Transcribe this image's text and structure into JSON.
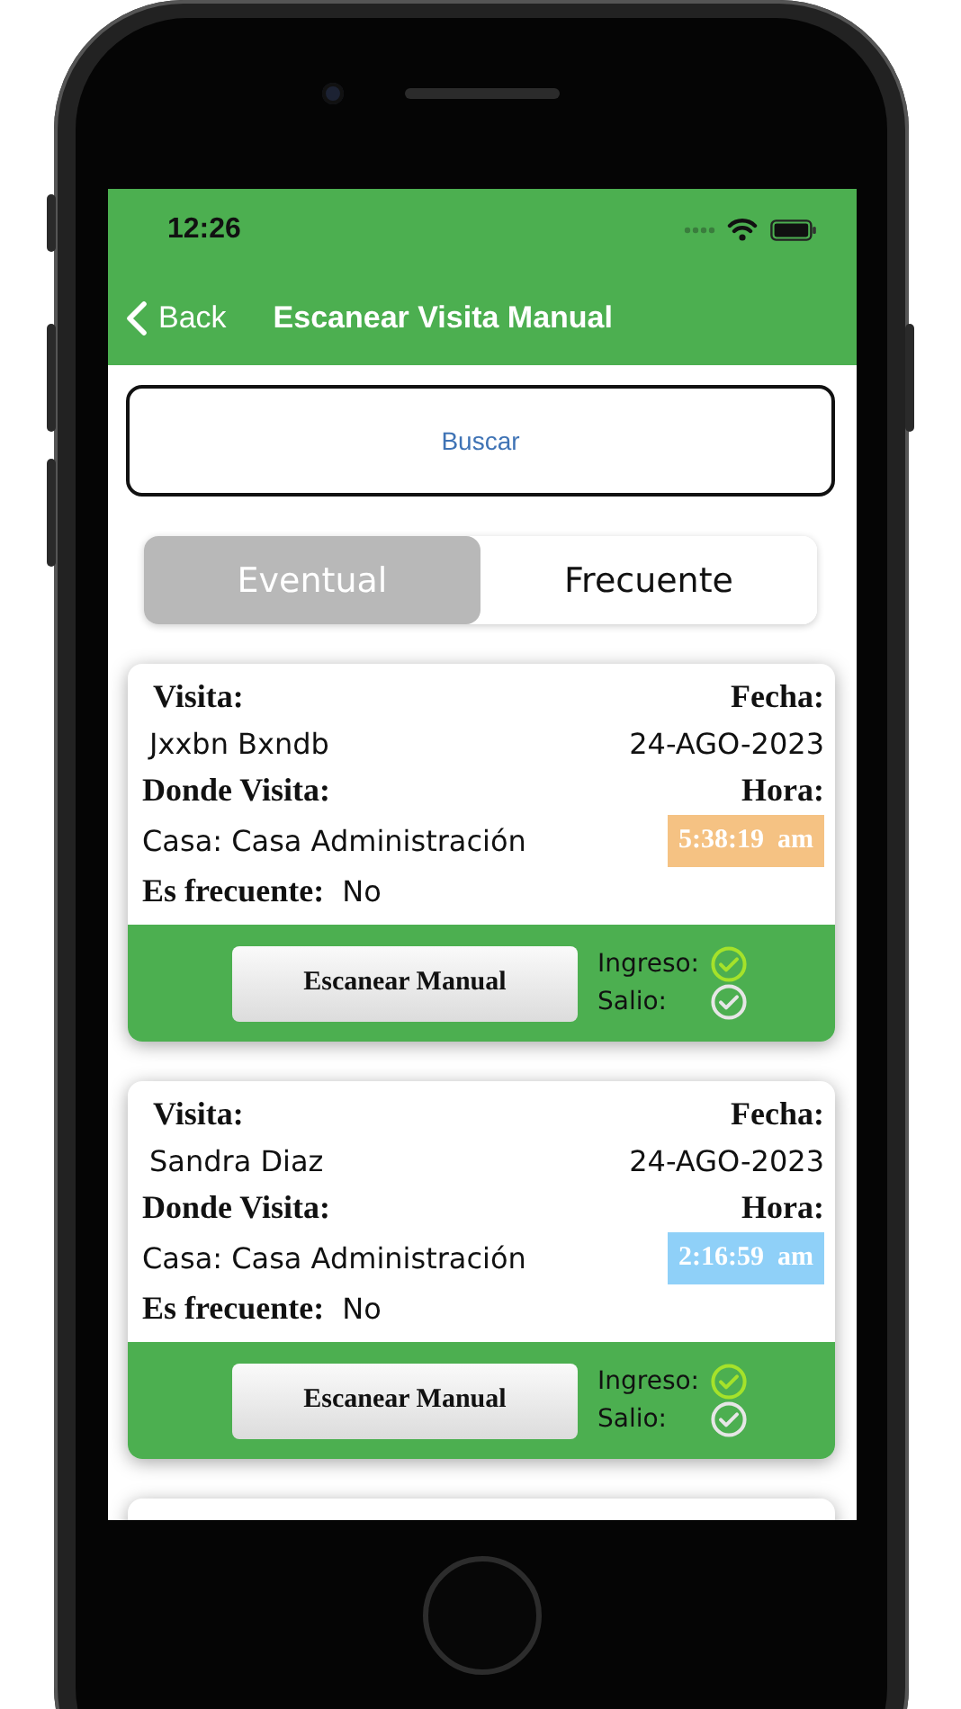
{
  "status_bar": {
    "time": "12:26"
  },
  "nav": {
    "back": "Back",
    "title": "Escanear Visita Manual"
  },
  "search": {
    "placeholder": "Buscar"
  },
  "tabs": [
    {
      "label": "Eventual",
      "selected": true
    },
    {
      "label": "Frecuente",
      "selected": false
    }
  ],
  "visits": [
    {
      "kind": "full",
      "visita_label": "Visita:",
      "visitor": "Jxxbn Bxndb",
      "fecha_label": "Fecha:",
      "date": "24-AGO-2023",
      "donde_label": "Donde Visita:",
      "place": "Casa: Casa Administración",
      "hora_label": "Hora:",
      "time": "5:38:19  am",
      "color": "#f5c283",
      "frecuente_label": "Es frecuente:",
      "frecuente": "No",
      "button": "Escanear Manual",
      "checks": [
        {
          "label": "Ingreso:",
          "checked": true
        },
        {
          "label": "Salio:",
          "checked": false
        }
      ]
    },
    {
      "kind": "full",
      "visita_label": "Visita:",
      "visitor": "Sandra Diaz",
      "fecha_label": "Fecha:",
      "date": "24-AGO-2023",
      "donde_label": "Donde Visita:",
      "place": "Casa: Casa Administración",
      "hora_label": "Hora:",
      "time": "2:16:59  am",
      "color": "#8fd0f8",
      "frecuente_label": "Es frecuente:",
      "frecuente": "No",
      "button": "Escanear Manual",
      "checks": [
        {
          "label": "Ingreso:",
          "checked": true
        },
        {
          "label": "Salio:",
          "checked": false
        }
      ]
    },
    {
      "kind": "partial"
    }
  ]
}
